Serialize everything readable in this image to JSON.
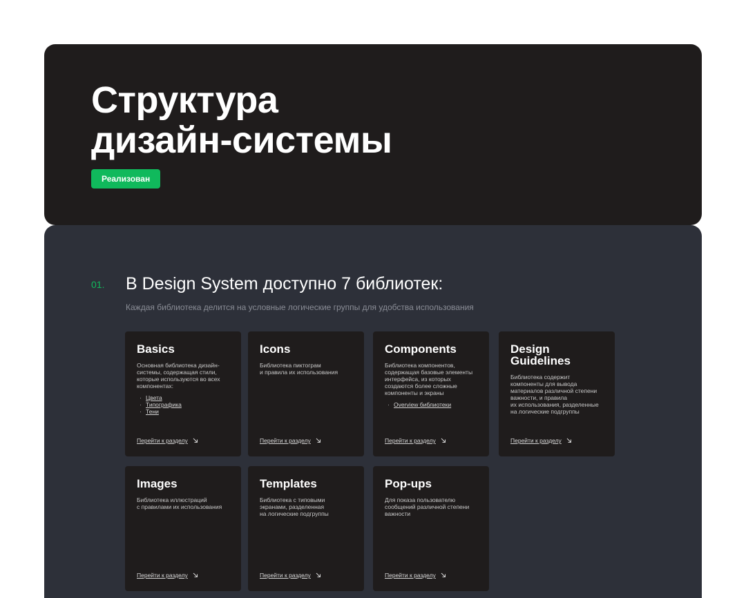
{
  "hero": {
    "title": "Структура\nдизайн-системы",
    "badge": "Реализован"
  },
  "section": {
    "number": "01.",
    "title": "В Design System доступно 7 библиотек:",
    "subtitle": "Каждая библиотека делится на условные логические группы для удобства использования"
  },
  "colors": {
    "accent": "#10B95C",
    "hero_bg": "#1F1C1C",
    "section_bg": "#2D3039",
    "card_bg": "#1F1C1C"
  },
  "cards": [
    {
      "title": "Basics",
      "desc": "Основная библиотека дизайн-\nсистемы, содержащая стили,\nкоторые используются во всех\nкомпонентах:",
      "items": [
        "Цвета",
        "Типографика",
        "Тени"
      ],
      "link": "Перейти к разделу"
    },
    {
      "title": "Icons",
      "desc": "Библиотека пиктограм\nи правила их использования",
      "items": [],
      "link": "Перейти к разделу"
    },
    {
      "title": "Components",
      "desc": "Библиотека компонентов,\nсодержащая базовые элементы\nинтерфейса, из которых\nсоздаются более сложные\nкомпоненты и экраны",
      "items": [
        "Overview библиотеки"
      ],
      "link": "Перейти к разделу"
    },
    {
      "title": "Design\nGuidelines",
      "desc": "Библиотека содержит\nкомпоненты для вывода\nматериалов различной степени\nважности, и правила\nих использования, разделенные\nна логические подгруппы",
      "items": [],
      "link": "Перейти к разделу"
    },
    {
      "title": "Images",
      "desc": "Библиотека иллюстраций\nс правилами их использования",
      "items": [],
      "link": "Перейти к разделу"
    },
    {
      "title": "Templates",
      "desc": "Библиотека с типовыми\nэкранами, разделенная\nна логические подгруппы",
      "items": [],
      "link": "Перейти к разделу"
    },
    {
      "title": "Pop-ups",
      "desc": "Для показа пользователю\nсообщений различной степени\nважности",
      "items": [],
      "link": "Перейти к разделу"
    }
  ]
}
